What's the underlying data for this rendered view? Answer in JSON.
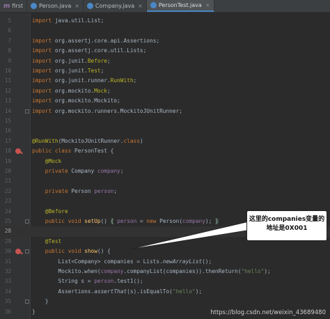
{
  "tabs": [
    {
      "label": "first",
      "kind": "project",
      "icon": "module-icon",
      "closable": false
    },
    {
      "label": "Person.java",
      "kind": "file",
      "icon": "class-icon",
      "closable": true
    },
    {
      "label": "Company.java",
      "kind": "file",
      "icon": "class-icon",
      "closable": true
    },
    {
      "label": "PersonTest.java",
      "kind": "file",
      "icon": "test-class-icon",
      "closable": true,
      "active": true
    }
  ],
  "close_glyph": "×",
  "project_glyph": "m",
  "editor": {
    "current_line": "28",
    "lines": [
      {
        "n": "5",
        "html": "<span class=\"kw\">import</span> java.util.List;"
      },
      {
        "n": "6",
        "html": ""
      },
      {
        "n": "7",
        "html": "<span class=\"kw\">import</span> org.assertj.core.api.Assertions;"
      },
      {
        "n": "8",
        "html": "<span class=\"kw\">import</span> org.assertj.core.util.Lists;"
      },
      {
        "n": "9",
        "html": "<span class=\"kw\">import</span> org.junit.<span class=\"an\">Before</span>;"
      },
      {
        "n": "10",
        "html": "<span class=\"kw\">import</span> org.junit.<span class=\"an\">Test</span>;"
      },
      {
        "n": "11",
        "html": "<span class=\"kw\">import</span> org.junit.runner.<span class=\"an\">RunWith</span>;"
      },
      {
        "n": "12",
        "html": "<span class=\"kw\">import</span> org.mockito.<span class=\"an\">Mock</span>;"
      },
      {
        "n": "13",
        "html": "<span class=\"kw\">import</span> org.mockito.Mockito;"
      },
      {
        "n": "14",
        "html": "<span class=\"kw\">import</span> org.mockito.runners.MockitoJUnitRunner;",
        "fold": true
      },
      {
        "n": "15",
        "html": ""
      },
      {
        "n": "16",
        "html": ""
      },
      {
        "n": "17",
        "html": "<span class=\"an\">@RunWith</span>(MockitoJUnitRunner.<span class=\"kw\">class</span>)"
      },
      {
        "n": "18",
        "html": "<span class=\"kw\">public class</span> PersonTest {",
        "marker": true
      },
      {
        "n": "19",
        "html": "    <span class=\"an\">@Mock</span>"
      },
      {
        "n": "20",
        "html": "    <span class=\"kw\">private</span> Company <span class=\"fd\">company</span>;"
      },
      {
        "n": "21",
        "html": ""
      },
      {
        "n": "22",
        "html": "    <span class=\"kw\">private</span> Person <span class=\"fd\">person</span>;"
      },
      {
        "n": "23",
        "html": ""
      },
      {
        "n": "24",
        "html": "    <span class=\"an\">@Before</span>"
      },
      {
        "n": "25",
        "html": "    <span class=\"kw\">public void</span> <span class=\"mt\">setUp</span>() <span class=\"hl\">{</span> <span class=\"fd\">person</span> = <span class=\"kw\">new</span> Person(<span class=\"fd\">company</span>); <span class=\"hl\">}</span>",
        "fold": true
      },
      {
        "n": "28",
        "html": ""
      },
      {
        "n": "29",
        "html": "    <span class=\"an\">@Test</span>"
      },
      {
        "n": "30",
        "html": "    <span class=\"kw\">public void</span> <span class=\"mt\">show</span>() {",
        "marker": true,
        "fold": true
      },
      {
        "n": "31",
        "html": "        List&lt;Company&gt; companies = Lists.<span class=\"it\">newArrayList</span>();"
      },
      {
        "n": "32",
        "html": "        Mockito.<span class=\"it\">when</span>(<span class=\"fd\">company</span>.companyList(companies)).thenReturn(<span class=\"st\">\"hello\"</span>);"
      },
      {
        "n": "33",
        "html": "        String s = <span class=\"fd\">person</span>.test1();"
      },
      {
        "n": "34",
        "html": "        Assertions.<span class=\"it\">assertThat</span>(s).isEqualTo(<span class=\"st\">\"hello\"</span>);"
      },
      {
        "n": "35",
        "html": "    }",
        "fold": true
      },
      {
        "n": "36",
        "html": "}"
      },
      {
        "n": "37",
        "html": ""
      }
    ]
  },
  "annotation": {
    "line1": "这里的companies变量的",
    "line2": "地址是0X001"
  },
  "watermark": "https://blog.csdn.net/weixin_43689480",
  "colors": {
    "keyword": "#cc7832",
    "annotation": "#bbb529",
    "field": "#9876aa",
    "string": "#6a8759",
    "method": "#ffc66d",
    "breakpoint": "#c75450"
  }
}
